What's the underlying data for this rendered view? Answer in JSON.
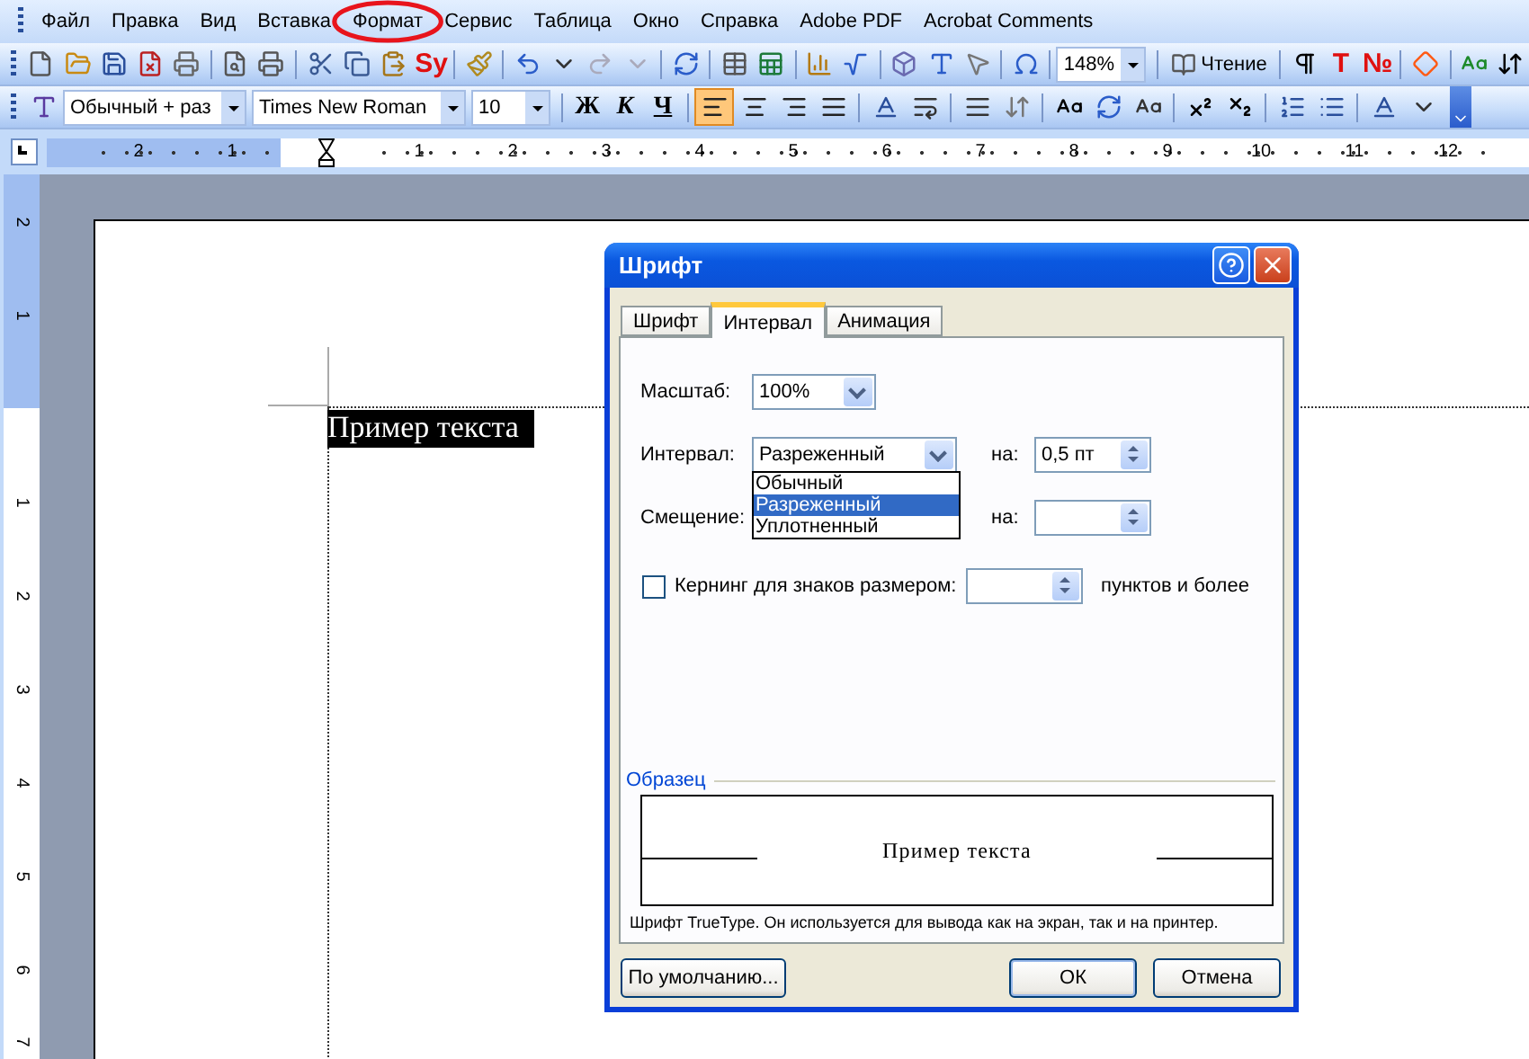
{
  "menu_bar": {
    "items": [
      {
        "label": "Файл",
        "circled": false
      },
      {
        "label": "Правка",
        "circled": false
      },
      {
        "label": "Вид",
        "circled": false
      },
      {
        "label": "Вставка",
        "circled": false
      },
      {
        "label": "Формат",
        "circled": true
      },
      {
        "label": "Сервис",
        "circled": false
      },
      {
        "label": "Таблица",
        "circled": false
      },
      {
        "label": "Окно",
        "circled": false
      },
      {
        "label": "Справка",
        "circled": false
      },
      {
        "label": "Adobe PDF",
        "circled": false
      },
      {
        "label": "Acrobat Comments",
        "circled": false
      }
    ]
  },
  "standard_toolbar": {
    "spelling_glyph": "Sy",
    "zoom": "148%",
    "reading_button": "Чтение",
    "text_glyphs": [
      "T",
      "№"
    ]
  },
  "formatting_toolbar": {
    "style": "Обычный + раз",
    "font": "Times New Roman",
    "size": "10",
    "format_buttons": [
      "Ж",
      "К",
      "Ч"
    ],
    "alignment": [
      {
        "selected": true
      },
      {
        "selected": false
      },
      {
        "selected": false
      },
      {
        "selected": false
      }
    ]
  },
  "horizontal_ruler": {
    "left_labels": [
      "2",
      "1"
    ],
    "right_labels": [
      "1",
      "2",
      "3",
      "4",
      "5",
      "6",
      "7",
      "8",
      "9",
      "10",
      "11",
      "12"
    ]
  },
  "vertical_ruler": {
    "top_labels": [
      "2",
      "1"
    ],
    "bottom_labels": [
      "1",
      "2",
      "3",
      "4",
      "5",
      "6",
      "7"
    ]
  },
  "document": {
    "text": "Пример текста"
  },
  "dialog": {
    "title": "Шрифт",
    "tabs": [
      {
        "label": "Шрифт",
        "selected": false
      },
      {
        "label": "Интервал",
        "selected": true
      },
      {
        "label": "Анимация",
        "selected": false
      }
    ],
    "scale": {
      "label": "Масштаб:",
      "value": "100%"
    },
    "spacing": {
      "label": "Интервал:",
      "value": "Разреженный",
      "by_label": "на:",
      "by_value": "0,5 пт",
      "options": [
        {
          "label": "Обычный",
          "selected": false
        },
        {
          "label": "Разреженный",
          "selected": true
        },
        {
          "label": "Уплотненный",
          "selected": false
        }
      ]
    },
    "position": {
      "label": "Смещение:",
      "by_label": "на:"
    },
    "kerning": {
      "label": "Кернинг для знаков размером:",
      "checked": false,
      "suffix": "пунктов и более"
    },
    "preview": {
      "legend": "Образец",
      "text": "Пример текста",
      "note": "Шрифт TrueType. Он используется для вывода как на экран, так и на принтер."
    },
    "buttons": {
      "default": "По умолчанию...",
      "ok": "ОК",
      "cancel": "Отмена"
    }
  }
}
